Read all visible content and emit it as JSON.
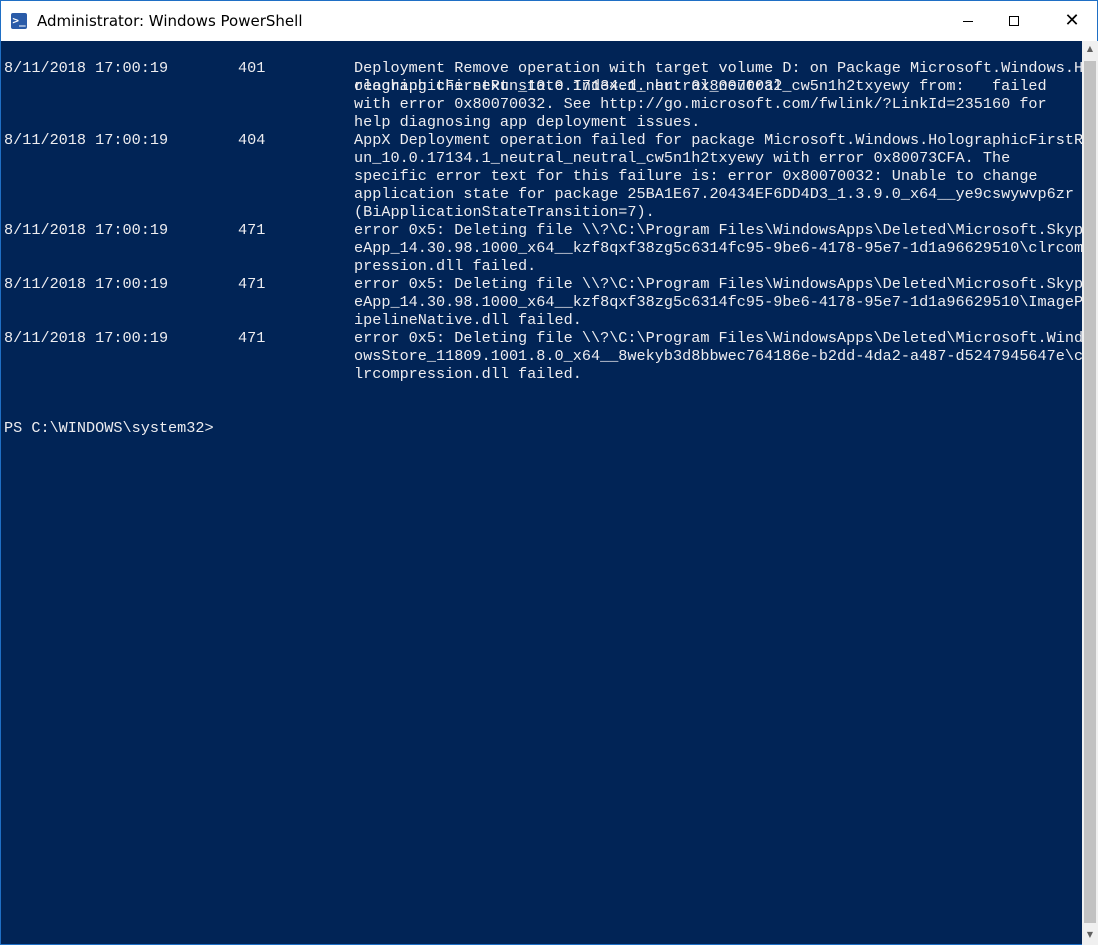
{
  "window": {
    "title": "Administrator: Windows PowerShell",
    "icon": "powershell-icon",
    "background": "#012456",
    "foreground": "#eeedf0"
  },
  "log": {
    "continuation": [
      "reaching the next state Indexed. hr: 0x80070032"
    ],
    "entries": [
      {
        "date": "8/11/2018 17:00:19",
        "code": "401",
        "lines": [
          "Deployment Remove operation with target volume D: on Package Microsoft.Windows.H",
          "olographicFirstRun_10.0.17134.1_neutral_neutral_cw5n1h2txyewy from:   failed",
          "with error 0x80070032. See http://go.microsoft.com/fwlink/?LinkId=235160 for",
          "help diagnosing app deployment issues."
        ]
      },
      {
        "date": "8/11/2018 17:00:19",
        "code": "404",
        "lines": [
          "AppX Deployment operation failed for package Microsoft.Windows.HolographicFirstR",
          "un_10.0.17134.1_neutral_neutral_cw5n1h2txyewy with error 0x80073CFA. The",
          "specific error text for this failure is: error 0x80070032: Unable to change",
          "application state for package 25BA1E67.20434EF6DD4D3_1.3.9.0_x64__ye9cswywvp6zr",
          "(BiApplicationStateTransition=7)."
        ]
      },
      {
        "date": "8/11/2018 17:00:19",
        "code": "471",
        "lines": [
          "error 0x5: Deleting file \\\\?\\C:\\Program Files\\WindowsApps\\Deleted\\Microsoft.Skyp",
          "eApp_14.30.98.1000_x64__kzf8qxf38zg5c6314fc95-9be6-4178-95e7-1d1a96629510\\clrcom",
          "pression.dll failed."
        ]
      },
      {
        "date": "8/11/2018 17:00:19",
        "code": "471",
        "lines": [
          "error 0x5: Deleting file \\\\?\\C:\\Program Files\\WindowsApps\\Deleted\\Microsoft.Skyp",
          "eApp_14.30.98.1000_x64__kzf8qxf38zg5c6314fc95-9be6-4178-95e7-1d1a96629510\\ImageP",
          "ipelineNative.dll failed."
        ]
      },
      {
        "date": "8/11/2018 17:00:19",
        "code": "471",
        "lines": [
          "error 0x5: Deleting file \\\\?\\C:\\Program Files\\WindowsApps\\Deleted\\Microsoft.Wind",
          "owsStore_11809.1001.8.0_x64__8wekyb3d8bbwec764186e-b2dd-4da2-a487-d5247945647e\\c",
          "lrcompression.dll failed."
        ]
      }
    ]
  },
  "prompt": "PS C:\\WINDOWS\\system32>"
}
